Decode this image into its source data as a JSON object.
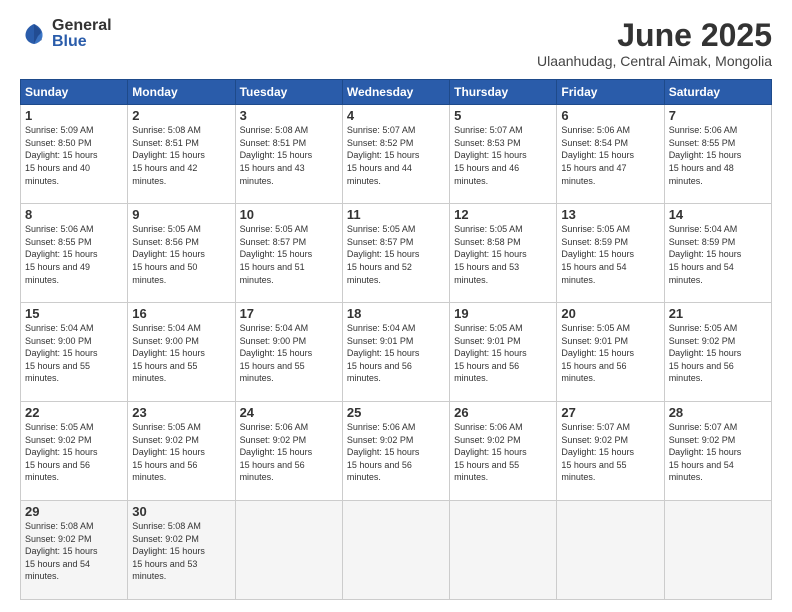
{
  "logo": {
    "general": "General",
    "blue": "Blue"
  },
  "header": {
    "month": "June 2025",
    "location": "Ulaanhudag, Central Aimak, Mongolia"
  },
  "weekdays": [
    "Sunday",
    "Monday",
    "Tuesday",
    "Wednesday",
    "Thursday",
    "Friday",
    "Saturday"
  ],
  "weeks": [
    [
      {
        "day": "1",
        "sunrise": "5:09 AM",
        "sunset": "8:50 PM",
        "daylight": "15 hours and 40 minutes."
      },
      {
        "day": "2",
        "sunrise": "5:08 AM",
        "sunset": "8:51 PM",
        "daylight": "15 hours and 42 minutes."
      },
      {
        "day": "3",
        "sunrise": "5:08 AM",
        "sunset": "8:51 PM",
        "daylight": "15 hours and 43 minutes."
      },
      {
        "day": "4",
        "sunrise": "5:07 AM",
        "sunset": "8:52 PM",
        "daylight": "15 hours and 44 minutes."
      },
      {
        "day": "5",
        "sunrise": "5:07 AM",
        "sunset": "8:53 PM",
        "daylight": "15 hours and 46 minutes."
      },
      {
        "day": "6",
        "sunrise": "5:06 AM",
        "sunset": "8:54 PM",
        "daylight": "15 hours and 47 minutes."
      },
      {
        "day": "7",
        "sunrise": "5:06 AM",
        "sunset": "8:55 PM",
        "daylight": "15 hours and 48 minutes."
      }
    ],
    [
      {
        "day": "8",
        "sunrise": "5:06 AM",
        "sunset": "8:55 PM",
        "daylight": "15 hours and 49 minutes."
      },
      {
        "day": "9",
        "sunrise": "5:05 AM",
        "sunset": "8:56 PM",
        "daylight": "15 hours and 50 minutes."
      },
      {
        "day": "10",
        "sunrise": "5:05 AM",
        "sunset": "8:57 PM",
        "daylight": "15 hours and 51 minutes."
      },
      {
        "day": "11",
        "sunrise": "5:05 AM",
        "sunset": "8:57 PM",
        "daylight": "15 hours and 52 minutes."
      },
      {
        "day": "12",
        "sunrise": "5:05 AM",
        "sunset": "8:58 PM",
        "daylight": "15 hours and 53 minutes."
      },
      {
        "day": "13",
        "sunrise": "5:05 AM",
        "sunset": "8:59 PM",
        "daylight": "15 hours and 54 minutes."
      },
      {
        "day": "14",
        "sunrise": "5:04 AM",
        "sunset": "8:59 PM",
        "daylight": "15 hours and 54 minutes."
      }
    ],
    [
      {
        "day": "15",
        "sunrise": "5:04 AM",
        "sunset": "9:00 PM",
        "daylight": "15 hours and 55 minutes."
      },
      {
        "day": "16",
        "sunrise": "5:04 AM",
        "sunset": "9:00 PM",
        "daylight": "15 hours and 55 minutes."
      },
      {
        "day": "17",
        "sunrise": "5:04 AM",
        "sunset": "9:00 PM",
        "daylight": "15 hours and 55 minutes."
      },
      {
        "day": "18",
        "sunrise": "5:04 AM",
        "sunset": "9:01 PM",
        "daylight": "15 hours and 56 minutes."
      },
      {
        "day": "19",
        "sunrise": "5:05 AM",
        "sunset": "9:01 PM",
        "daylight": "15 hours and 56 minutes."
      },
      {
        "day": "20",
        "sunrise": "5:05 AM",
        "sunset": "9:01 PM",
        "daylight": "15 hours and 56 minutes."
      },
      {
        "day": "21",
        "sunrise": "5:05 AM",
        "sunset": "9:02 PM",
        "daylight": "15 hours and 56 minutes."
      }
    ],
    [
      {
        "day": "22",
        "sunrise": "5:05 AM",
        "sunset": "9:02 PM",
        "daylight": "15 hours and 56 minutes."
      },
      {
        "day": "23",
        "sunrise": "5:05 AM",
        "sunset": "9:02 PM",
        "daylight": "15 hours and 56 minutes."
      },
      {
        "day": "24",
        "sunrise": "5:06 AM",
        "sunset": "9:02 PM",
        "daylight": "15 hours and 56 minutes."
      },
      {
        "day": "25",
        "sunrise": "5:06 AM",
        "sunset": "9:02 PM",
        "daylight": "15 hours and 56 minutes."
      },
      {
        "day": "26",
        "sunrise": "5:06 AM",
        "sunset": "9:02 PM",
        "daylight": "15 hours and 55 minutes."
      },
      {
        "day": "27",
        "sunrise": "5:07 AM",
        "sunset": "9:02 PM",
        "daylight": "15 hours and 55 minutes."
      },
      {
        "day": "28",
        "sunrise": "5:07 AM",
        "sunset": "9:02 PM",
        "daylight": "15 hours and 54 minutes."
      }
    ],
    [
      {
        "day": "29",
        "sunrise": "5:08 AM",
        "sunset": "9:02 PM",
        "daylight": "15 hours and 54 minutes."
      },
      {
        "day": "30",
        "sunrise": "5:08 AM",
        "sunset": "9:02 PM",
        "daylight": "15 hours and 53 minutes."
      },
      null,
      null,
      null,
      null,
      null
    ]
  ]
}
